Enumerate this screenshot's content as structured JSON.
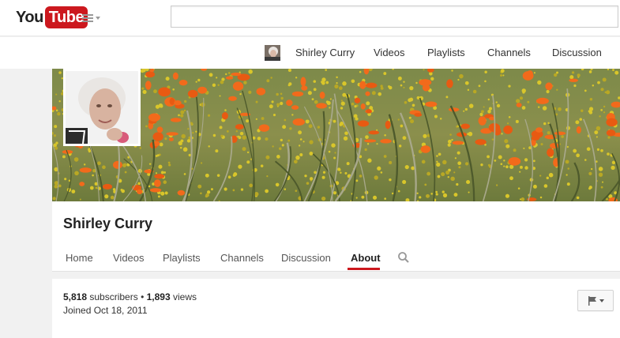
{
  "masthead": {
    "logo_you": "You",
    "logo_tube": "Tube",
    "search_placeholder": "",
    "search_value": ""
  },
  "channel_nav": {
    "items": [
      {
        "label": "Shirley Curry"
      },
      {
        "label": "Videos"
      },
      {
        "label": "Playlists"
      },
      {
        "label": "Channels"
      },
      {
        "label": "Discussion"
      }
    ]
  },
  "channel": {
    "title": "Shirley Curry",
    "tabs": [
      {
        "label": "Home",
        "active": false
      },
      {
        "label": "Videos",
        "active": false
      },
      {
        "label": "Playlists",
        "active": false
      },
      {
        "label": "Channels",
        "active": false
      },
      {
        "label": "Discussion",
        "active": false
      },
      {
        "label": "About",
        "active": true
      }
    ]
  },
  "about": {
    "subscribers": "5,818",
    "subscribers_label": "subscribers",
    "separator": "•",
    "views": "1,893",
    "views_label": "views",
    "joined": "Joined Oct 18, 2011"
  },
  "colors": {
    "brand_red": "#cc181e",
    "background": "#f1f1f1"
  },
  "icons": {
    "guide": "hamburger-menu-icon",
    "search": "magnifier-icon",
    "flag": "flag-icon"
  }
}
